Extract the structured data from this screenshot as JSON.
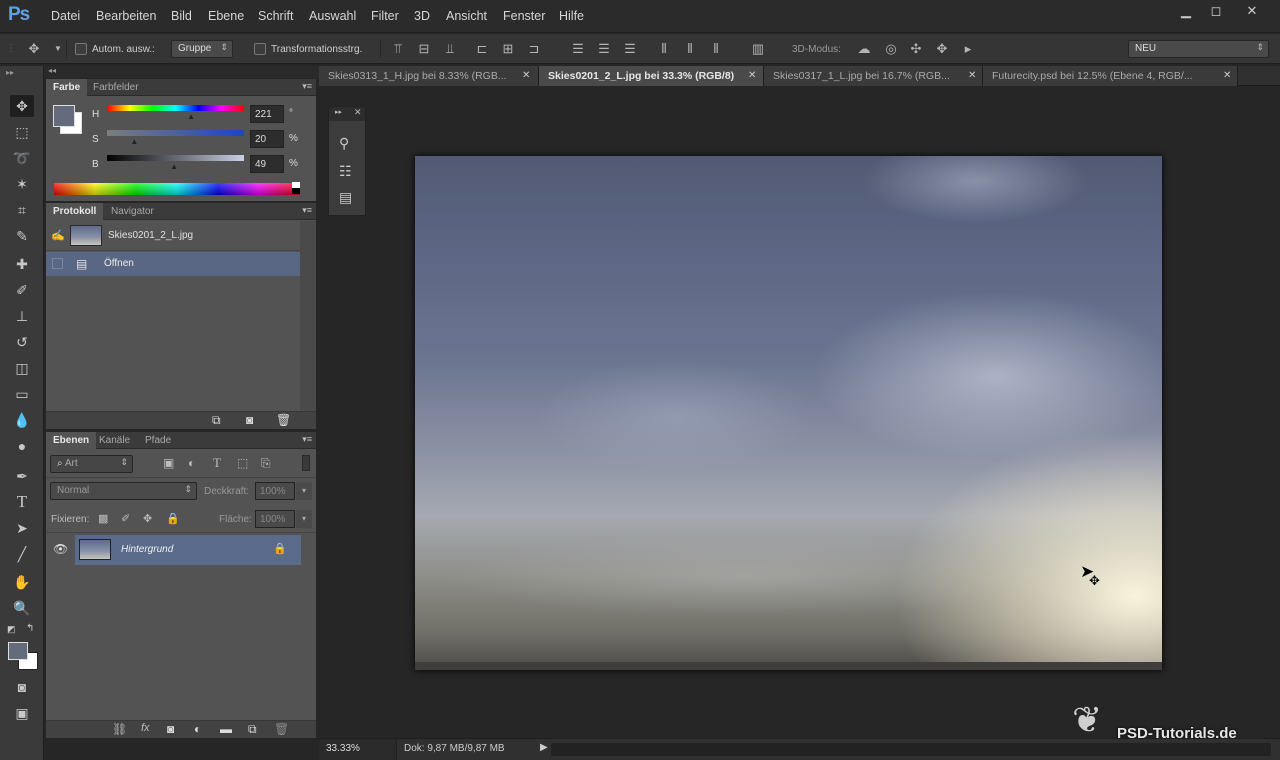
{
  "app": {
    "logo": "Ps"
  },
  "menu": [
    "Datei",
    "Bearbeiten",
    "Bild",
    "Ebene",
    "Schrift",
    "Auswahl",
    "Filter",
    "3D",
    "Ansicht",
    "Fenster",
    "Hilfe"
  ],
  "window_controls": {
    "minimize": "▁",
    "maximize": "◻",
    "close": "✕"
  },
  "options": {
    "auto_select_label": "Autom. ausw.:",
    "auto_select_value": "Gruppe",
    "transform_label": "Transformationsstrg.",
    "mode3d_label": "3D-Modus:",
    "workspace": "NEU"
  },
  "doc_tabs": [
    {
      "label": "Skies0313_1_H.jpg bei 8.33% (RGB...",
      "close": "✕",
      "active": false
    },
    {
      "label": "Skies0201_2_L.jpg bei 33.3% (RGB/8)",
      "close": "✕",
      "active": true
    },
    {
      "label": "Skies0317_1_L.jpg bei 16.7% (RGB...",
      "close": "✕",
      "active": false
    },
    {
      "label": "Futurecity.psd bei 12.5% (Ebene 4, RGB/...",
      "close": "✕",
      "active": false
    }
  ],
  "color_panel": {
    "tabs": [
      "Farbe",
      "Farbfelder"
    ],
    "sliders": [
      {
        "name": "H",
        "value": "221",
        "unit": "°",
        "level": 0.614
      },
      {
        "name": "S",
        "value": "20",
        "unit": "%",
        "level": 0.2
      },
      {
        "name": "B",
        "value": "49",
        "unit": "%",
        "level": 0.49
      }
    ],
    "fg_color": "#646b7d",
    "bg_color": "#ffffff"
  },
  "history_panel": {
    "tabs": [
      "Protokoll",
      "Navigator"
    ],
    "snapshot": "Skies0201_2_L.jpg",
    "steps": [
      "Öffnen"
    ]
  },
  "layers_panel": {
    "tabs": [
      "Ebenen",
      "Kanäle",
      "Pfade"
    ],
    "filter_placeholder": "Art",
    "blend_mode": "Normal",
    "opacity_label": "Deckkraft:",
    "opacity_value": "100%",
    "lock_label": "Fixieren:",
    "fill_label": "Fläche:",
    "fill_value": "100%",
    "layers": [
      {
        "name": "Hintergrund",
        "locked": true,
        "visible": true
      }
    ]
  },
  "status": {
    "zoom": "33.33%",
    "doc_info": "Dok: 9,87 MB/9,87 MB"
  },
  "watermark": "PSD-Tutorials.de"
}
